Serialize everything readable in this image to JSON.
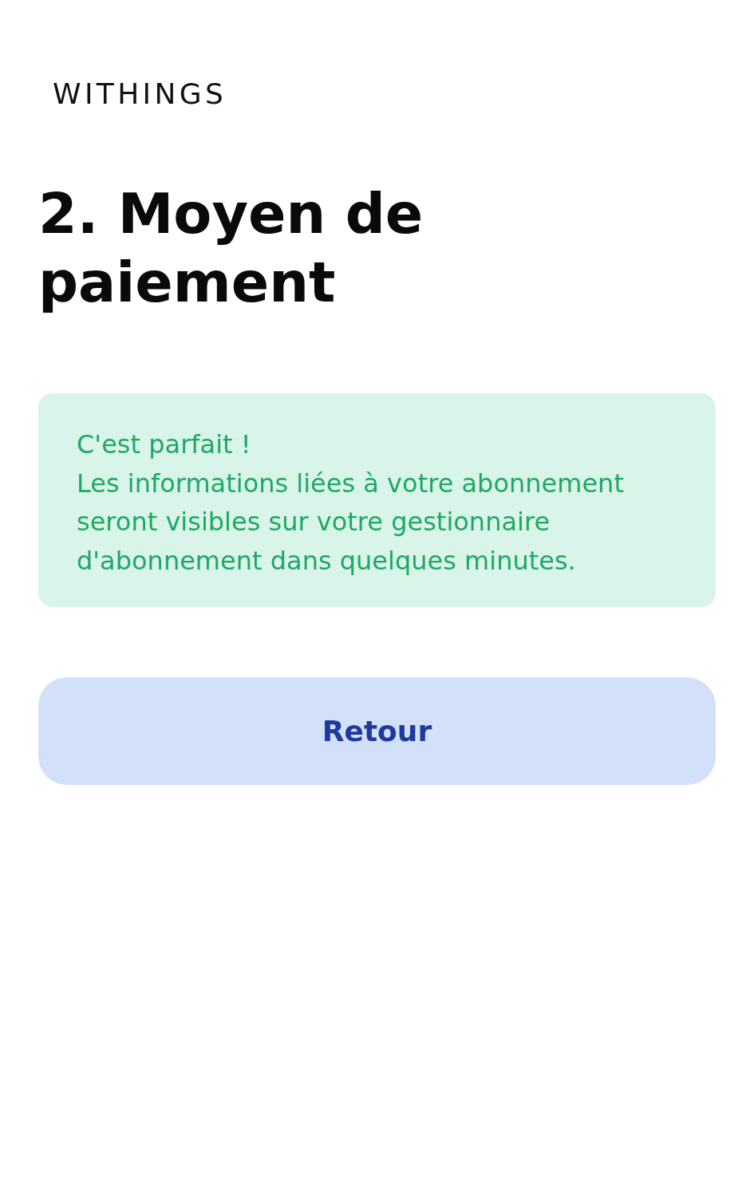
{
  "logo": "WITHINGS",
  "heading": "2. Moyen de paiement",
  "notice": {
    "title": "C'est parfait !",
    "body": "Les informations liées à votre abonnement seront visibles sur votre gestionnaire d'abonnement dans quelques minutes."
  },
  "buttons": [
    {
      "label": "Retour"
    }
  ]
}
